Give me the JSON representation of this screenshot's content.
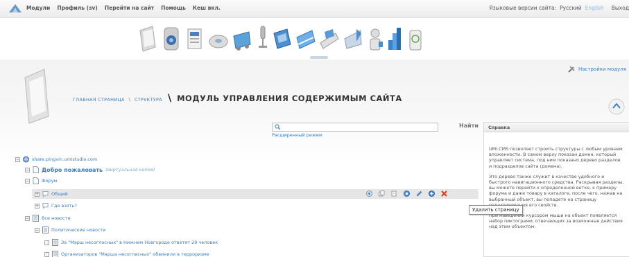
{
  "topbar": {
    "menu": [
      "Модули",
      "Профиль (sv)",
      "Перейти на сайт",
      "Помощь",
      "Кеш вкл."
    ],
    "lang_label": "Языковые версии сайта:",
    "lang_ru": "Русский",
    "lang_en": "English",
    "logout": "Выход"
  },
  "module_icons": [
    "structure-icon",
    "speaker-icon",
    "news-icon",
    "disc-icon",
    "eshop-icon",
    "vote-icon",
    "catalog-icon",
    "banner-icon",
    "email-icon",
    "user-icon",
    "stats-icon",
    "trash-icon"
  ],
  "header": {
    "settings_link": "Настройки модуля",
    "crumb_home": "главная страница",
    "crumb_sep": "\\",
    "crumb_structure": "структура",
    "title_sep": "\\",
    "title": "МОДУЛЬ УПРАВЛЕНИЯ СОДЕРЖИМЫМ САЙТА"
  },
  "search": {
    "value": "",
    "button": "Найти",
    "advanced": "Расширенный режим"
  },
  "tree": {
    "root": "share.pingvin.umistudio.com",
    "welcome": "Добро пожаловать",
    "welcome_note": "(виртуальная копия)",
    "forum": "Форум",
    "general": "Общий",
    "where": "Где взять?",
    "all_news": "Все новости",
    "politics": "Политические новости",
    "news1": "За \"Марш несогласных\" в Нижнем Новгороде ответят 29 человек",
    "news2": "Организаторов \"Марша несогласных\" обвинили в терроризме"
  },
  "row_actions": [
    "view-icon",
    "copy-icon",
    "clone-icon",
    "activity-icon",
    "edit-icon",
    "add-icon",
    "delete-icon"
  ],
  "tooltip": "Удалить страницу",
  "help": {
    "title": "Справка",
    "p1": "UMI.CMS позволяет строить структуры с любым уровнем вложенности. В самом верху показан домен, который управляет система, под ним показано дерево разделов и подразделов сайта (домена).",
    "p2": "Это дерево также служит в качестве удобного и быстрого навигационного средства. Раскрывая разделы, вы можете перейти к определенной ветке, к примеру форума и даже товару в каталоге, после чего, нажав на выбранный объект, вы попадете на страницу редактирования его свойств.",
    "p3": "При наведении курсором мыши на объект появляется набор пиктограмм, отвечающих за возможные действия над этим объектом:"
  },
  "colors": {
    "link": "#3a7cc0",
    "delete": "#e03b24",
    "accent": "#8fb7de"
  }
}
